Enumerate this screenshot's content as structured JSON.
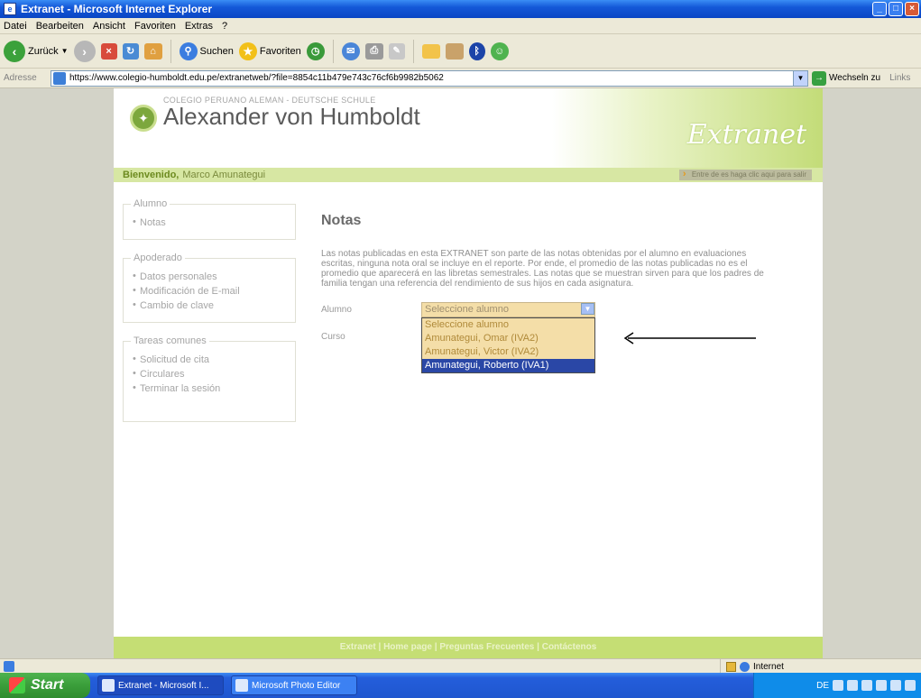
{
  "window": {
    "title": "Extranet - Microsoft Internet Explorer"
  },
  "menu": [
    "Datei",
    "Bearbeiten",
    "Ansicht",
    "Favoriten",
    "Extras",
    "?"
  ],
  "toolbar": {
    "back": "Zurück",
    "search": "Suchen",
    "favorites": "Favoriten"
  },
  "address": {
    "label": "Adresse",
    "url": "https://www.colegio-humboldt.edu.pe/extranetweb/?file=8854c11b479e743c76cf6b9982b5062",
    "go": "Wechseln zu",
    "links": "Links"
  },
  "site": {
    "subtitle": "COLEGIO PERUANO ALEMAN - DEUTSCHE SCHULE",
    "name": "Alexander von Humboldt",
    "extranet_logo": "Extranet",
    "welcome_label": "Bienvenido,",
    "welcome_user": "Marco Amunategui",
    "homepage_link": "Entre de es haga clic aqui para salir"
  },
  "sidebar": {
    "alumno": {
      "title": "Alumno",
      "items": [
        "Notas"
      ]
    },
    "apoderado": {
      "title": "Apoderado",
      "items": [
        "Datos personales",
        "Modificación de E-mail",
        "Cambio de clave"
      ]
    },
    "tareas": {
      "title": "Tareas comunes",
      "items": [
        "Solicitud de cita",
        "Circulares",
        "Terminar la sesión"
      ]
    }
  },
  "main": {
    "title": "Notas",
    "intro": "Las notas publicadas en esta EXTRANET son parte de las notas obtenidas por el alumno en evaluaciones escritas, ninguna nota oral se incluye en el reporte. Por ende, el promedio de las notas publicadas no es el promedio que aparecerá en las libretas semestrales. Las notas que se muestran sirven para que los padres de familia tengan una referencia del rendimiento de sus hijos en cada asignatura.",
    "alumno_label": "Alumno",
    "curso_label": "Curso",
    "select_value": "Seleccione alumno",
    "options": [
      "Seleccione alumno",
      "Amunategui, Omar (IVA2)",
      "Amunategui, Victor (IVA2)",
      "Amunategui, Roberto (IVA1)"
    ],
    "selected_index": 3
  },
  "footer": {
    "text": "Extranet | Home page | Preguntas Frecuentes | Contáctenos"
  },
  "status": {
    "zone": "Internet"
  },
  "taskbar": {
    "start": "Start",
    "items": [
      "Extranet - Microsoft I...",
      "Microsoft Photo Editor"
    ],
    "lang": "DE"
  }
}
